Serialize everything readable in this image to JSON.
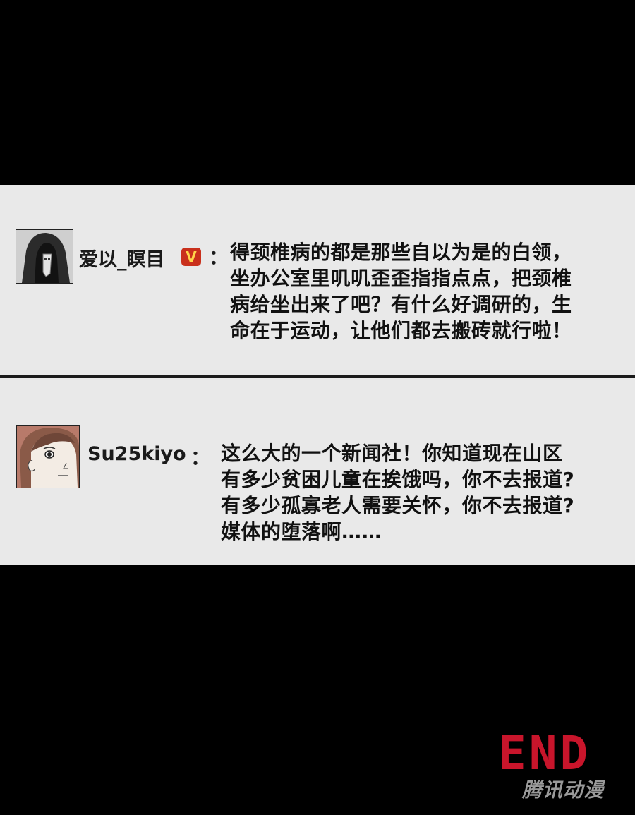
{
  "comments": [
    {
      "username": "爱以_瞑目",
      "badge": "V",
      "separator": "：",
      "lines": [
        "得颈椎病的都是那些自以为是的白领，",
        "坐办公室里叽叽歪歪指指点点，把颈椎",
        "病给坐出来了吧？有什么好调研的，生",
        "命在于运动，让他们都去搬砖就行啦！"
      ]
    },
    {
      "username": "Su25kiyo",
      "separator": "：",
      "lines": [
        "这么大的一个新闻社！你知道现在山区",
        "有多少贫困儿童在挨饿吗，你不去报道?",
        "有多少孤寡老人需要关怀，你不去报道?",
        "媒体的堕落啊……"
      ]
    }
  ],
  "end_label": "END",
  "watermark": "腾讯动漫",
  "colors": {
    "background": "#000000",
    "panel": "#e9e9e9",
    "end_red": "#c8152b",
    "badge_red": "#c9301c",
    "badge_gold": "#ffd54a"
  }
}
